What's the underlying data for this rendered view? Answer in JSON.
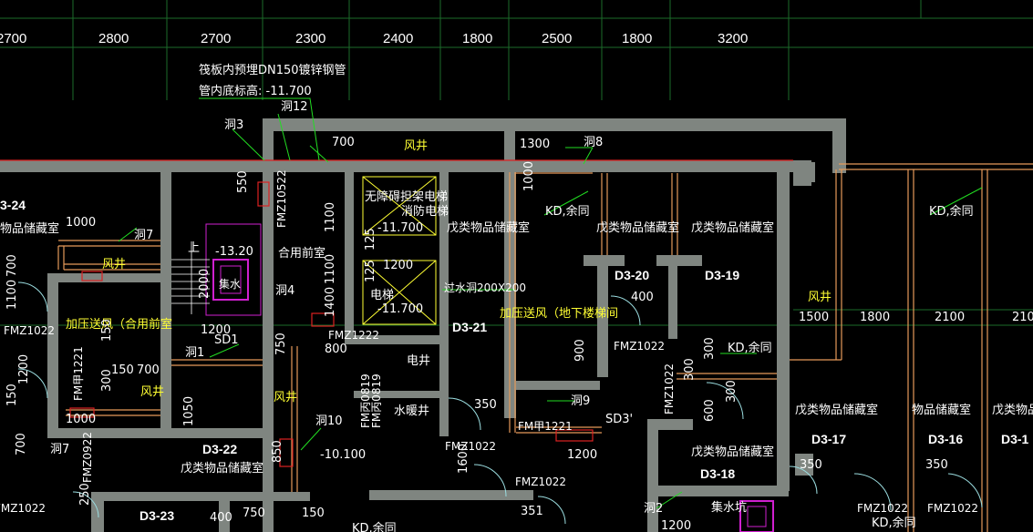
{
  "colors": {
    "background": "#000000",
    "wall": "#7f8580",
    "grid": "#1c6b2a",
    "leader": "#22dd22",
    "text": "#ffffff",
    "highlight_text": "#ffff33",
    "door": "#9bdde0",
    "pipe_red": "#dd2222",
    "pipe_orange": "#e59a5a",
    "equipment_magenta": "#d020d0"
  },
  "dimensions_top": [
    "2700",
    "2800",
    "2700",
    "2300",
    "2400",
    "1800",
    "2500",
    "1800",
    "3200"
  ],
  "notes": {
    "pipe_note_1": "筏板内预埋DN150镀锌钢管",
    "pipe_note_2": "管内底标高: -11.700"
  },
  "openings": [
    "洞3",
    "洞12",
    "洞8",
    "洞7",
    "洞4",
    "洞1",
    "洞10",
    "洞9",
    "洞2"
  ],
  "rooms": {
    "d3_24": "3-24",
    "d3_21": "D3-21",
    "d3_20": "D3-20",
    "d3_19": "D3-19",
    "d3_22": "D3-22",
    "d3_23": "D3-23",
    "d3_18": "D3-18",
    "d3_17": "D3-17",
    "d3_16": "D3-16",
    "d3_1x": "D3-1",
    "storage": "戊类物品储藏室",
    "storage_short": "物品储藏室",
    "storage_cut": "戊类物品储",
    "storage_bottom_cut": "戊类物品储藏室"
  },
  "shafts": {
    "wind": "风井",
    "elec": "电井",
    "water": "水暖井",
    "pressurized_shared": "加压送风（合用前室",
    "pressurized_stair": "加压送风（地下楼梯间",
    "shared_vestibule": "合用前室",
    "elevator": "电梯",
    "elevator_level": "-11.700",
    "fire_elevator": "无障碍担架电梯",
    "fire_elevator_2": "消防电梯",
    "fire_elevator_level": "-11.700",
    "sump": "集水坑",
    "stair_up": "上",
    "stair_level": "-13.20",
    "shaft_cut": "集水"
  },
  "doors": {
    "fmz1022": "FMZ1022",
    "fmz1022_a": "FMZ1022",
    "fmz1022_b": "FMZ1022",
    "fmz1022_c": "FMZ1022",
    "fmz1022_d": "FMZ1022",
    "fmz1022_e": "FMZ1022",
    "fmz1022_f": "FMZ1022",
    "fmz1222": "FMZ1222",
    "fmz1221": "FM甲1221",
    "fmz0922": "FMZ0922",
    "fmz10522": "FMZ10522",
    "fm1221b": "FM甲1221",
    "fm0819": "FM丙0819",
    "fm0819b": "FM丙0819",
    "fmz1022v": "FMZ1022"
  },
  "tags": {
    "kd": "KD,余同",
    "kd2": "KD,余同",
    "kd3": "KD,余同",
    "kd4": "KD,余同",
    "kd_bottom": "KD,余同",
    "sd1": "SD1",
    "sd3": "SD3'",
    "vent_hole": "过水洞200X200"
  },
  "dims": {
    "d700": "700",
    "d1300": "1300",
    "d550": "550",
    "d1100": "1100",
    "d1000": "1000",
    "d1000b": "1000",
    "d700b": "700",
    "d2000": "2000",
    "d1200": "1200",
    "d1200b": "1200",
    "d1400": "1400",
    "d800": "800",
    "d1050": "1050",
    "d900": "900",
    "d400": "400",
    "d300": "300",
    "d300b": "300",
    "d600": "600",
    "d1500": "1500",
    "d1800": "1800",
    "d2100": "2100",
    "d210": "210",
    "d350": "350",
    "d350b": "350",
    "d350c": "350",
    "d351": "351",
    "d150": "150",
    "d150b": "150",
    "d850": "850",
    "d750": "750",
    "d1600": "1600",
    "d1200c": "1200",
    "d1200d": "1200",
    "d150c": "150",
    "d250": "250",
    "d400b": "400",
    "d700c": "700",
    "d1100b": "1100",
    "d1200e": "1200",
    "d1022": "1022",
    "level_10100": "-10.100",
    "d125": "125",
    "d125b": "125",
    "d300c": "300",
    "d150d": "150",
    "d1200f": "1200",
    "d700d": "700",
    "d1100c": "1100",
    "d1000c": "1000"
  }
}
